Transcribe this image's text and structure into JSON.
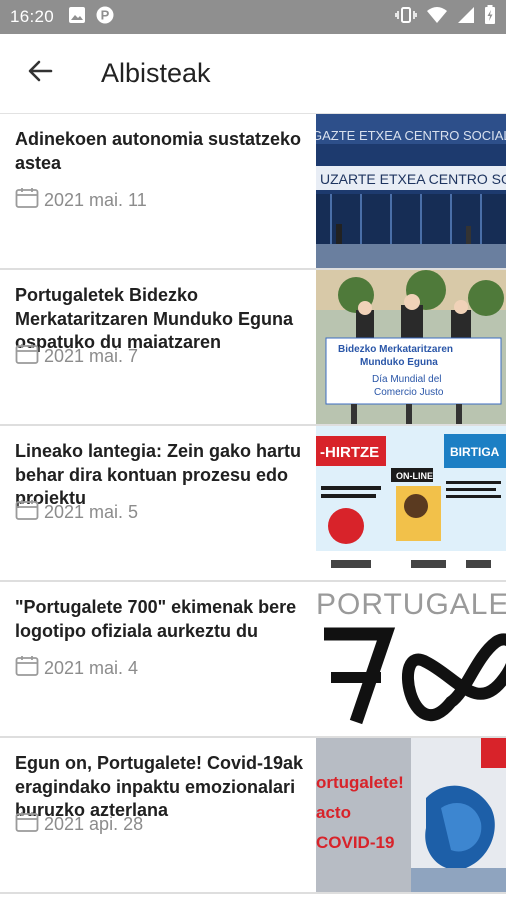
{
  "status_bar": {
    "time": "16:20",
    "icons": [
      "image-icon",
      "parking-icon",
      "vibrate-icon",
      "wifi-icon",
      "signal-icon",
      "battery-icon"
    ]
  },
  "app_bar": {
    "title": "Albisteak",
    "back_icon": "arrow-back-icon"
  },
  "news": [
    {
      "title": "Adinekoen autonomia sustatzeko astea",
      "date": "2021 mai. 11",
      "thumb_text": [
        "GAZTE ETXEA  CENTRO SOCIAL",
        "UZARTE ETXEA  CENTRO SOCIAL SA"
      ]
    },
    {
      "title": "Portugaletek Bidezko Merkataritzaren Munduko Eguna ospatuko du maiatzaren",
      "date": "2021 mai. 7",
      "thumb_text": [
        "Bidezko Merkataritzaren",
        "Munduko Eguna",
        "Día Mundial del",
        "Comercio Justo"
      ]
    },
    {
      "title": "Lineako lantegia: Zein gako hartu behar dira kontuan prozesu edo proiektu",
      "date": "2021 mai. 5",
      "thumb_text": [
        "-HIRTZE",
        "ON-LINE",
        "BIRTIGA"
      ]
    },
    {
      "title": "\"Portugalete 700\" ekimenak bere logotipo ofiziala aurkeztu du",
      "date": "2021 mai. 4",
      "thumb_text": [
        "PORTUGALETE"
      ]
    },
    {
      "title": "Egun on, Portugalete! Covid-19ak eragindako inpaktu emozionalari buruzko azterlana",
      "date": "2021 api. 28",
      "thumb_text": [
        "ortugalete!",
        "acto",
        "COVID-19"
      ]
    }
  ]
}
